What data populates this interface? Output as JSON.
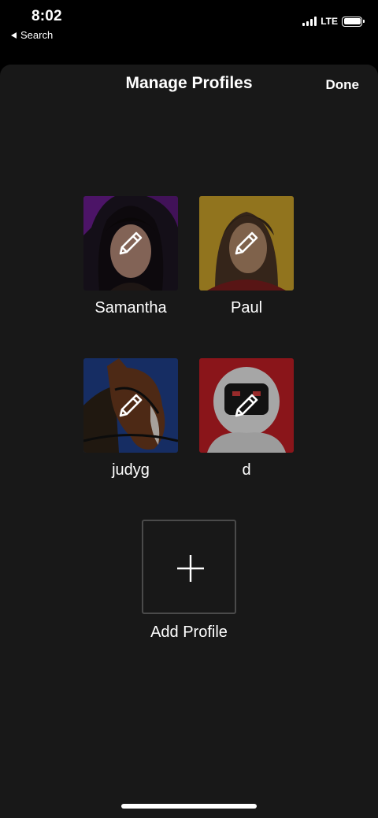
{
  "status_bar": {
    "time": "8:02",
    "back_label": "Search",
    "network": "LTE",
    "icons": [
      "signal-icon",
      "battery-icon"
    ]
  },
  "header": {
    "title": "Manage Profiles",
    "done_label": "Done"
  },
  "profiles": [
    {
      "name": "Samantha",
      "icon": "pencil-icon"
    },
    {
      "name": "Paul",
      "icon": "pencil-icon"
    },
    {
      "name": "judyg",
      "icon": "pencil-icon"
    },
    {
      "name": "d",
      "icon": "pencil-icon"
    }
  ],
  "add_profile": {
    "label": "Add Profile",
    "icon": "plus-icon"
  },
  "colors": {
    "background": "#000000",
    "sheet": "#181818",
    "text": "#ffffff",
    "add_border": "#4a4a4a"
  }
}
